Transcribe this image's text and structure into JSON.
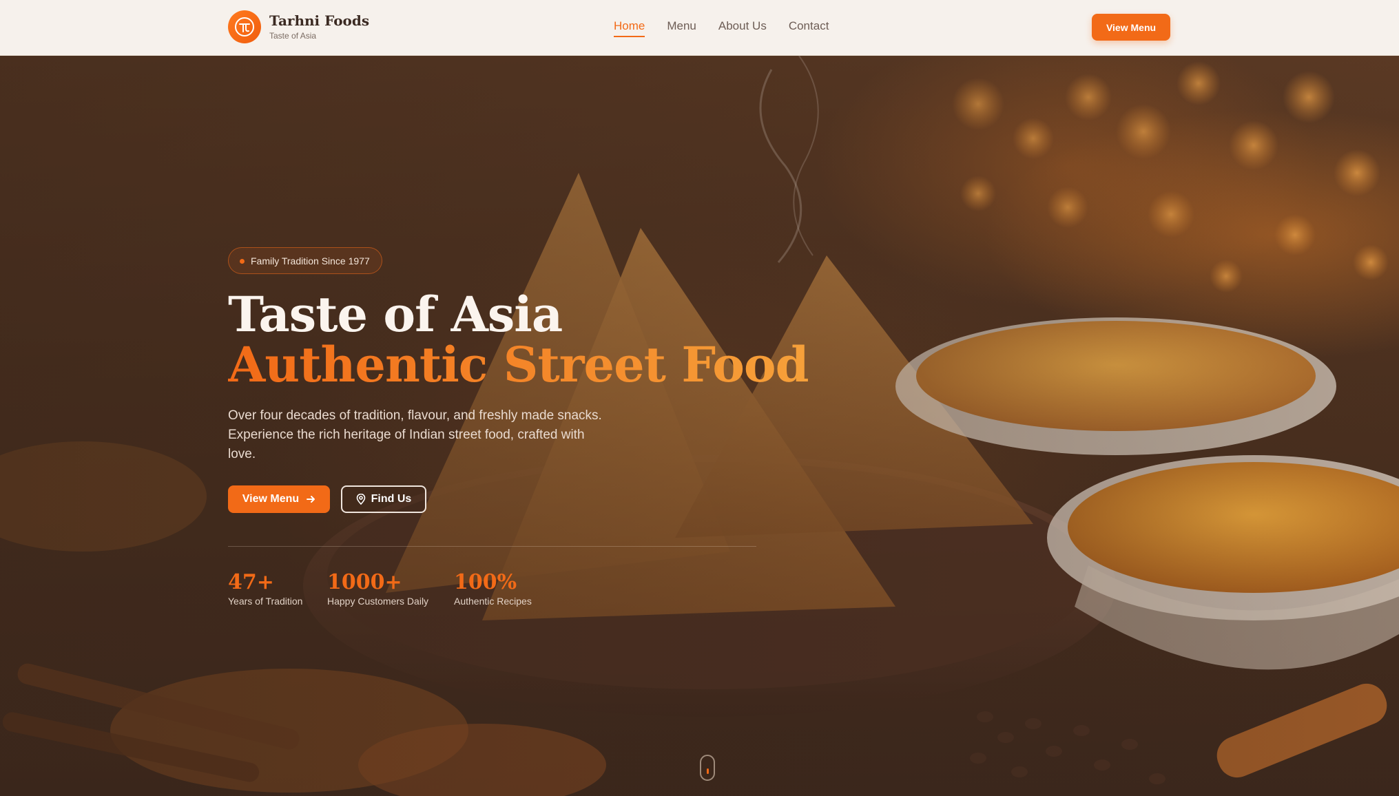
{
  "brand": {
    "name": "Tarhni Foods",
    "tagline": "Taste of Asia",
    "logo_icon": "tarhni-logo-icon"
  },
  "nav": {
    "items": [
      {
        "label": "Home",
        "active": true
      },
      {
        "label": "Menu",
        "active": false
      },
      {
        "label": "About Us",
        "active": false
      },
      {
        "label": "Contact",
        "active": false
      }
    ],
    "cta_label": "View Menu"
  },
  "hero": {
    "badge": "Family Tradition Since 1977",
    "title_line1": "Taste of Asia",
    "title_line2": "Authentic Street Food",
    "description": "Over four decades of tradition, flavour, and freshly made snacks. Experience the rich heritage of Indian street food, crafted with love.",
    "primary_button": "View Menu",
    "primary_icon": "arrow-right-icon",
    "secondary_button": "Find Us",
    "secondary_icon": "map-pin-icon",
    "stats": [
      {
        "value": "47+",
        "label": "Years of Tradition"
      },
      {
        "value": "1000+",
        "label": "Happy Customers Daily"
      },
      {
        "value": "100%",
        "label": "Authentic Recipes"
      }
    ]
  },
  "colors": {
    "accent": "#f26a17",
    "accent_light": "#f6a13a",
    "header_bg": "#f6f1ec",
    "hero_dark": "#3b271c"
  }
}
